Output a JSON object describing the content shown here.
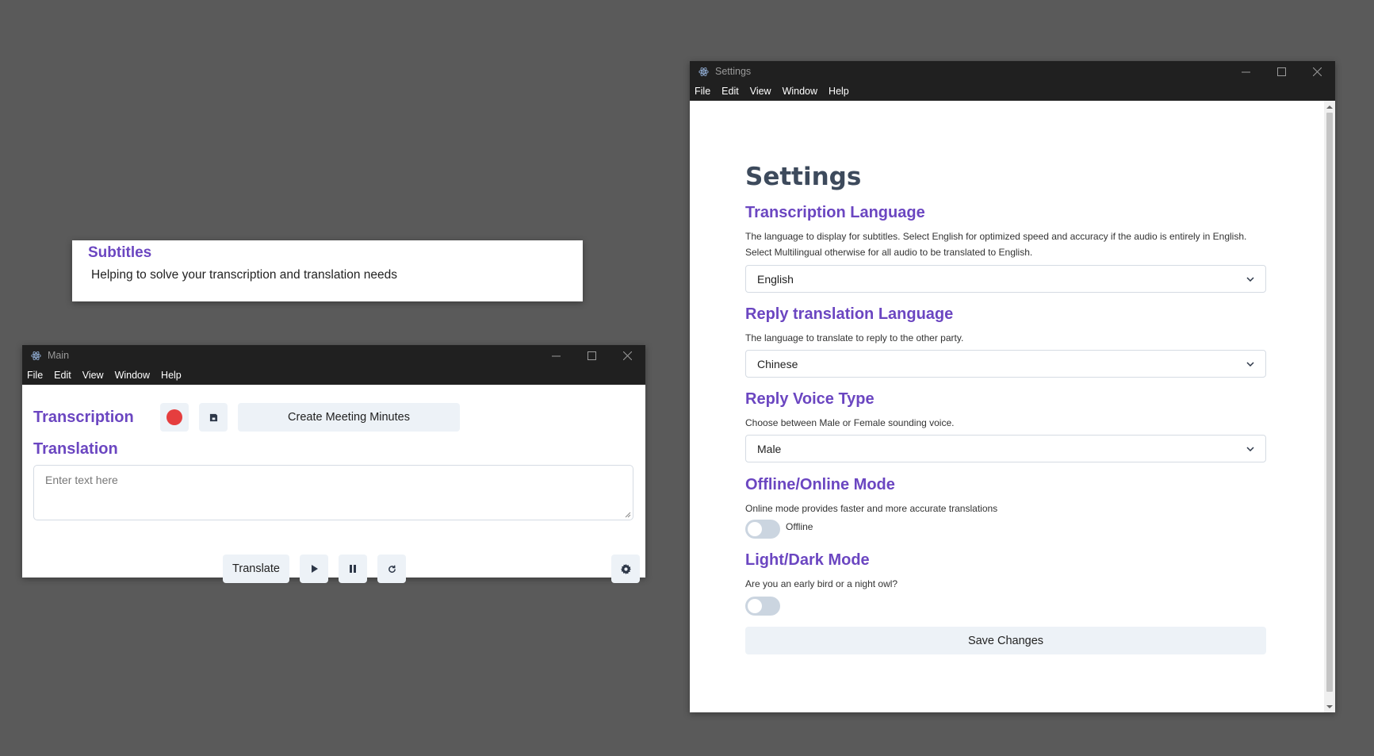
{
  "subtitles": {
    "title": "Subtitles",
    "text": "Helping to solve your transcription and translation needs"
  },
  "main_window": {
    "title": "Main",
    "menu": [
      "File",
      "Edit",
      "View",
      "Window",
      "Help"
    ],
    "transcription_heading": "Transcription",
    "record_icon": "record-icon",
    "save_icon": "save-icon",
    "create_minutes_label": "Create Meeting Minutes",
    "translation_heading": "Translation",
    "input_placeholder": "Enter text here",
    "translate_label": "Translate",
    "play_icon": "play-icon",
    "pause_icon": "pause-icon",
    "refresh_icon": "refresh-icon",
    "settings_icon": "gear-icon"
  },
  "settings_window": {
    "title": "Settings",
    "menu": [
      "File",
      "Edit",
      "View",
      "Window",
      "Help"
    ],
    "page_title": "Settings",
    "transcription_language": {
      "heading": "Transcription Language",
      "desc_line1": "The language to display for subtitles. Select English for optimized speed and accuracy if the audio is entirely in English.",
      "desc_line2": "Select Multilingual otherwise for all audio to be translated to English.",
      "value": "English"
    },
    "reply_language": {
      "heading": "Reply translation Language",
      "desc": "The language to translate to reply to the other party.",
      "value": "Chinese"
    },
    "reply_voice": {
      "heading": "Reply Voice Type",
      "desc": "Choose between Male or Female sounding voice.",
      "value": "Male"
    },
    "mode": {
      "heading": "Offline/Online Mode",
      "desc": "Online mode provides faster and more accurate translations",
      "toggle_label": "Offline",
      "enabled": false
    },
    "theme": {
      "heading": "Light/Dark Mode",
      "desc": "Are you an early bird or a night owl?",
      "enabled": false
    },
    "save_label": "Save Changes"
  },
  "colors": {
    "desktop": "#5a5a5a",
    "titlebar": "#202020",
    "accent_purple": "#6b46c1",
    "record_red": "#e53e3e",
    "button_bg": "#edf2f7"
  }
}
